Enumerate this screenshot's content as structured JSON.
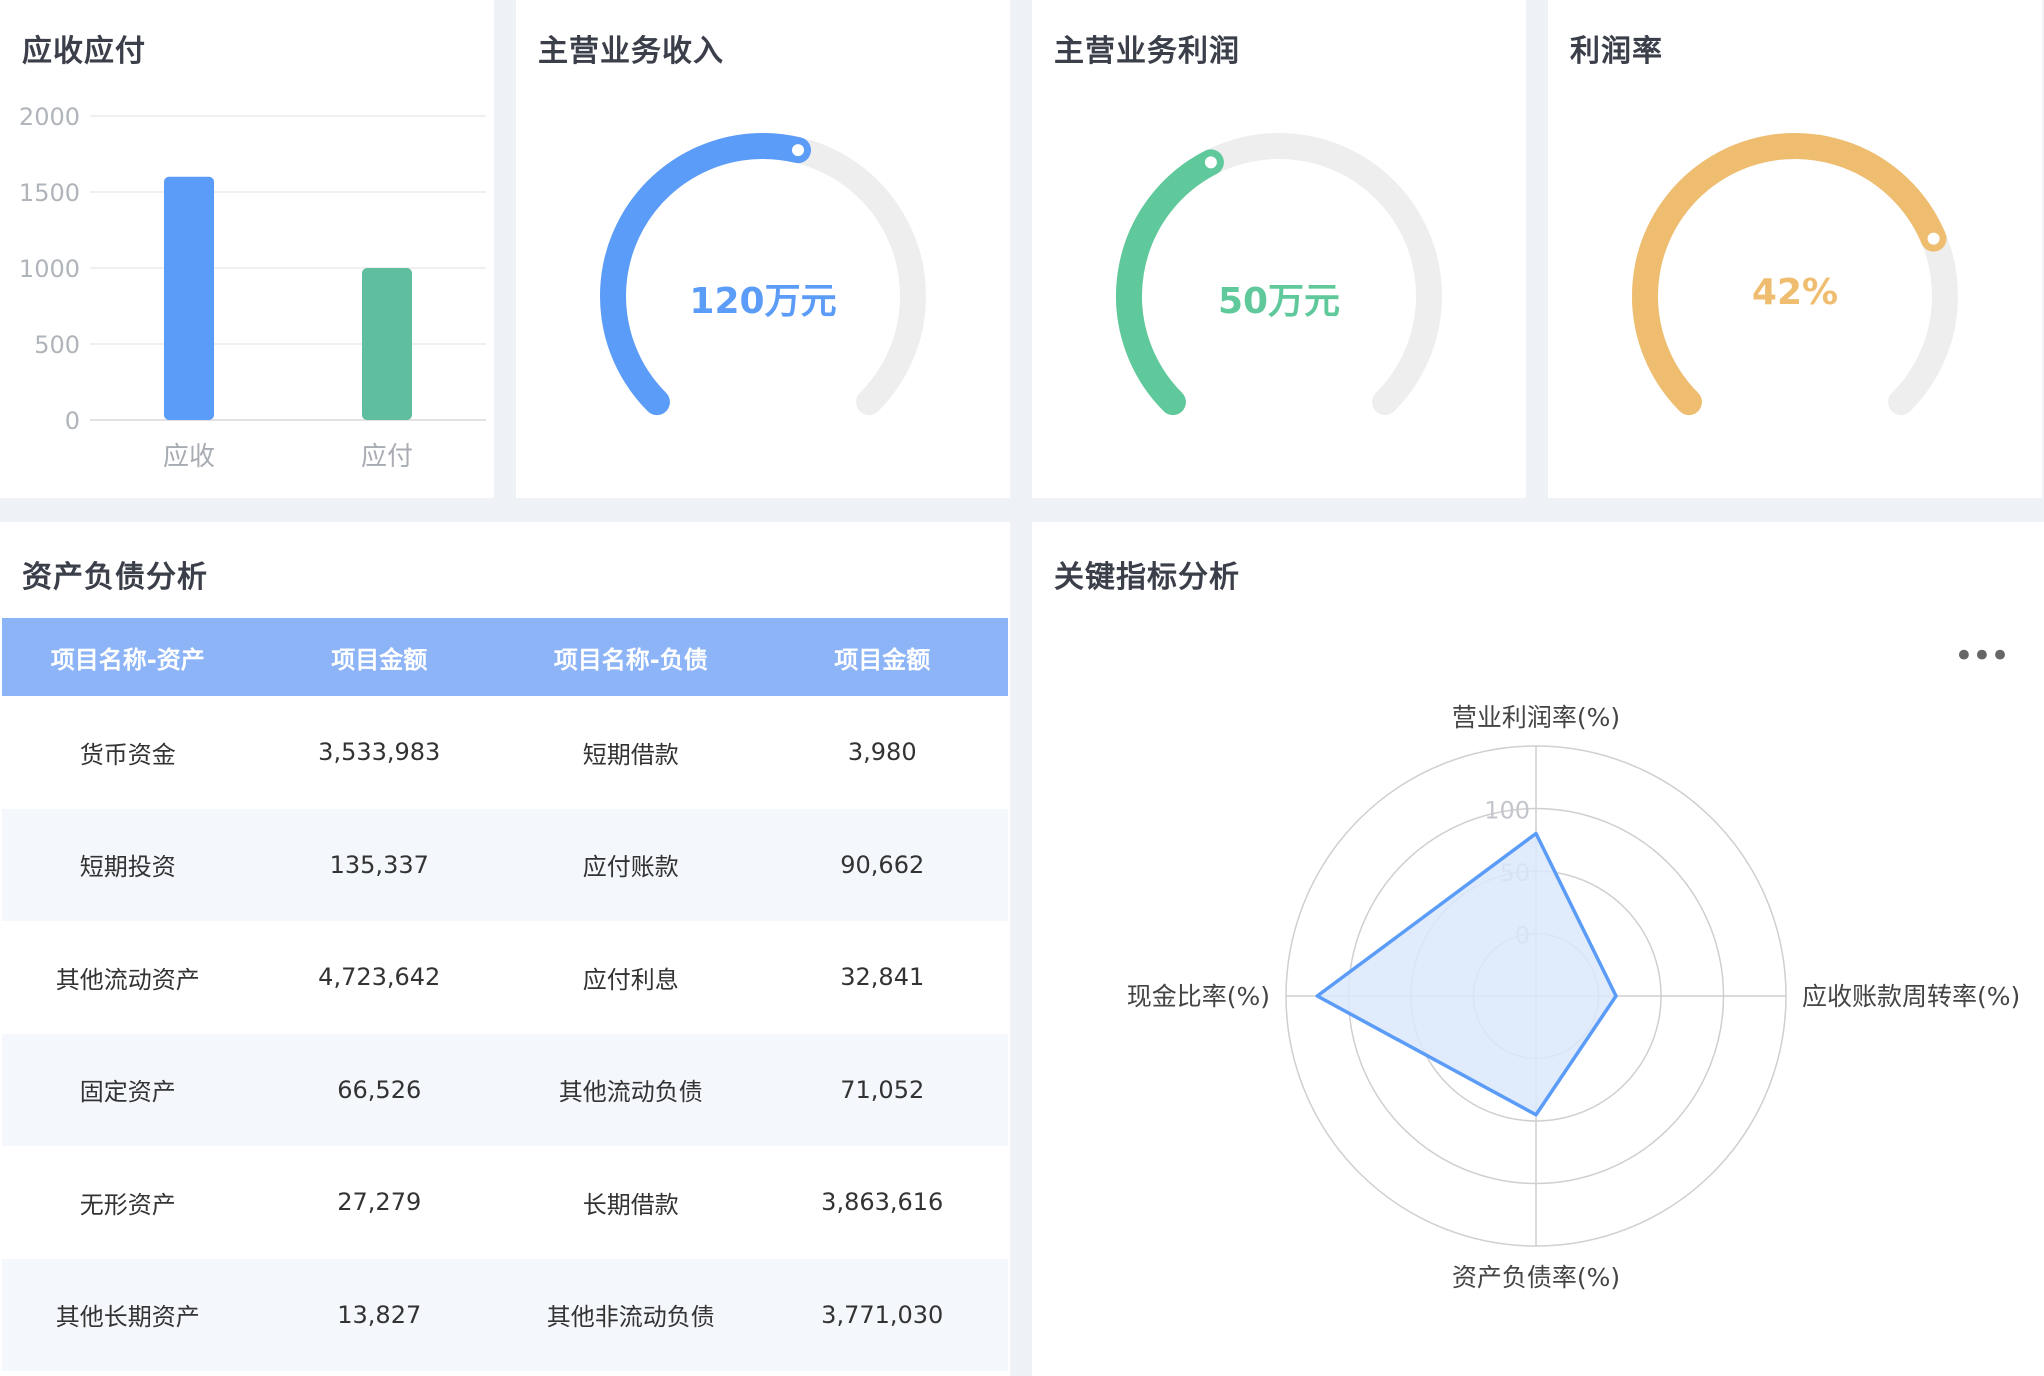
{
  "cards": {
    "receivable_payable": {
      "title": "应收应付",
      "chart_data": {
        "type": "bar",
        "categories": [
          "应收",
          "应付"
        ],
        "values": [
          1600,
          1000
        ],
        "ylim": [
          0,
          2000
        ],
        "yticks": [
          0,
          500,
          1000,
          1500,
          2000
        ],
        "colors": [
          "#5b9cf8",
          "#5fbe9f"
        ],
        "grid": true
      }
    },
    "revenue": {
      "title": "主营业务收入",
      "value_label": "120万元",
      "chart_data": {
        "type": "gauge",
        "value": 0.55,
        "color": "#5b9cf8"
      }
    },
    "profit": {
      "title": "主营业务利润",
      "value_label": "50万元",
      "chart_data": {
        "type": "gauge",
        "value": 0.4,
        "color": "#5fc99b"
      }
    },
    "margin": {
      "title": "利润率",
      "value_label": "42%",
      "chart_data": {
        "type": "gauge",
        "value": 0.75,
        "color": "#efbd6f"
      }
    }
  },
  "balance_sheet": {
    "title": "资产负债分析",
    "headers": [
      "项目名称-资产",
      "项目金额",
      "项目名称-负债",
      "项目金额"
    ],
    "rows": [
      [
        "货币资金",
        "3,533,983",
        "短期借款",
        "3,980"
      ],
      [
        "短期投资",
        "135,337",
        "应付账款",
        "90,662"
      ],
      [
        "其他流动资产",
        "4,723,642",
        "应付利息",
        "32,841"
      ],
      [
        "固定资产",
        "66,526",
        "其他流动负债",
        "71,052"
      ],
      [
        "无形资产",
        "27,279",
        "长期借款",
        "3,863,616"
      ],
      [
        "其他长期资产",
        "13,827",
        "其他非流动负债",
        "3,771,030"
      ]
    ]
  },
  "key_indicators": {
    "title": "关键指标分析",
    "more_icon": "more-horizontal-icon",
    "chart_data": {
      "type": "radar",
      "indicators": [
        "营业利润率(%)",
        "应收账款周转率(%)",
        "资产负债率(%)",
        "现金比率(%)"
      ],
      "values": [
        80,
        14,
        45,
        125
      ],
      "rlim": [
        -50,
        150
      ],
      "ticks": [
        0,
        50,
        100
      ],
      "color": "#5b9cf8",
      "fill": "#dbe8fc"
    }
  },
  "colors": {
    "background": "#eef1f5",
    "table_header": "#8db4f7",
    "gauge_track": "#eeeeee"
  }
}
